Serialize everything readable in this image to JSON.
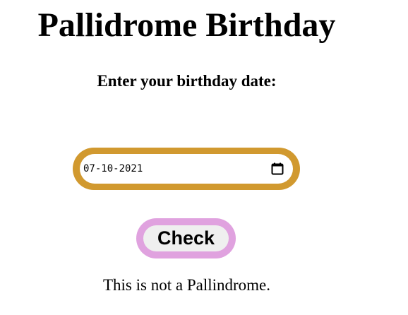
{
  "page": {
    "title": "Pallidrome Birthday",
    "prompt": "Enter your birthday date:"
  },
  "form": {
    "date_value": "07-10-2021",
    "check_label": "Check"
  },
  "result": {
    "message": "This is not a Pallindrome."
  },
  "icons": {
    "calendar": "calendar-icon"
  },
  "colors": {
    "date_border": "#d1992f",
    "button_border": "#e0a2df",
    "button_fill": "#efefef",
    "background": "#ffffff"
  }
}
